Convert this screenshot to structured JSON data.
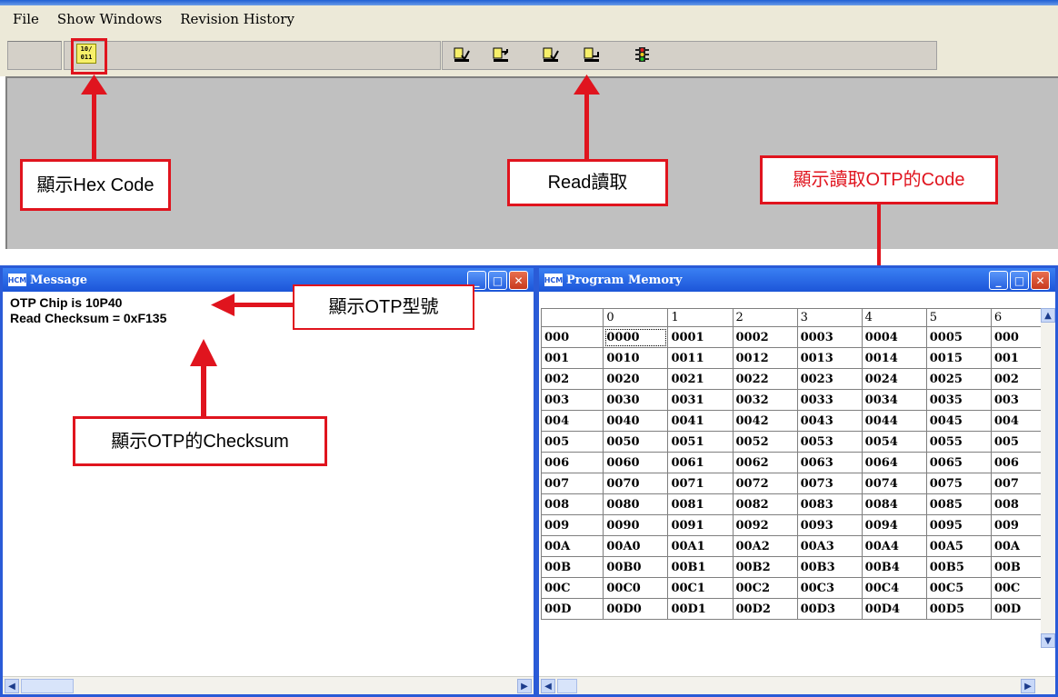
{
  "menu": {
    "items": [
      "File",
      "Show Windows",
      "Revision History"
    ]
  },
  "toolbar": {
    "hex_button_text": "10/ 011"
  },
  "annotations": {
    "hex": "顯示Hex Code",
    "read": "Read讀取",
    "otp_code": "顯示讀取OTP的Code",
    "otp_model": "顯示OTP型號",
    "checksum": "顯示OTP的Checksum"
  },
  "message_window": {
    "title": "Message",
    "lines": [
      "OTP Chip is 10P40",
      "Read Checksum = 0xF135"
    ]
  },
  "program_memory": {
    "title": "Program Memory",
    "columns": [
      "0",
      "1",
      "2",
      "3",
      "4",
      "5",
      "6"
    ],
    "rows": [
      {
        "addr": "000",
        "cells": [
          "0000",
          "0001",
          "0002",
          "0003",
          "0004",
          "0005",
          "000"
        ]
      },
      {
        "addr": "001",
        "cells": [
          "0010",
          "0011",
          "0012",
          "0013",
          "0014",
          "0015",
          "001"
        ]
      },
      {
        "addr": "002",
        "cells": [
          "0020",
          "0021",
          "0022",
          "0023",
          "0024",
          "0025",
          "002"
        ]
      },
      {
        "addr": "003",
        "cells": [
          "0030",
          "0031",
          "0032",
          "0033",
          "0034",
          "0035",
          "003"
        ]
      },
      {
        "addr": "004",
        "cells": [
          "0040",
          "0041",
          "0042",
          "0043",
          "0044",
          "0045",
          "004"
        ]
      },
      {
        "addr": "005",
        "cells": [
          "0050",
          "0051",
          "0052",
          "0053",
          "0054",
          "0055",
          "005"
        ]
      },
      {
        "addr": "006",
        "cells": [
          "0060",
          "0061",
          "0062",
          "0063",
          "0064",
          "0065",
          "006"
        ]
      },
      {
        "addr": "007",
        "cells": [
          "0070",
          "0071",
          "0072",
          "0073",
          "0074",
          "0075",
          "007"
        ]
      },
      {
        "addr": "008",
        "cells": [
          "0080",
          "0081",
          "0082",
          "0083",
          "0084",
          "0085",
          "008"
        ]
      },
      {
        "addr": "009",
        "cells": [
          "0090",
          "0091",
          "0092",
          "0093",
          "0094",
          "0095",
          "009"
        ]
      },
      {
        "addr": "00A",
        "cells": [
          "00A0",
          "00A1",
          "00A2",
          "00A3",
          "00A4",
          "00A5",
          "00A"
        ]
      },
      {
        "addr": "00B",
        "cells": [
          "00B0",
          "00B1",
          "00B2",
          "00B3",
          "00B4",
          "00B5",
          "00B"
        ]
      },
      {
        "addr": "00C",
        "cells": [
          "00C0",
          "00C1",
          "00C2",
          "00C3",
          "00C4",
          "00C5",
          "00C"
        ]
      },
      {
        "addr": "00D",
        "cells": [
          "00D0",
          "00D1",
          "00D2",
          "00D3",
          "00D4",
          "00D5",
          "00D"
        ]
      }
    ]
  },
  "colors": {
    "annotation": "#e0141e",
    "titlebar": "#1c55d8"
  }
}
